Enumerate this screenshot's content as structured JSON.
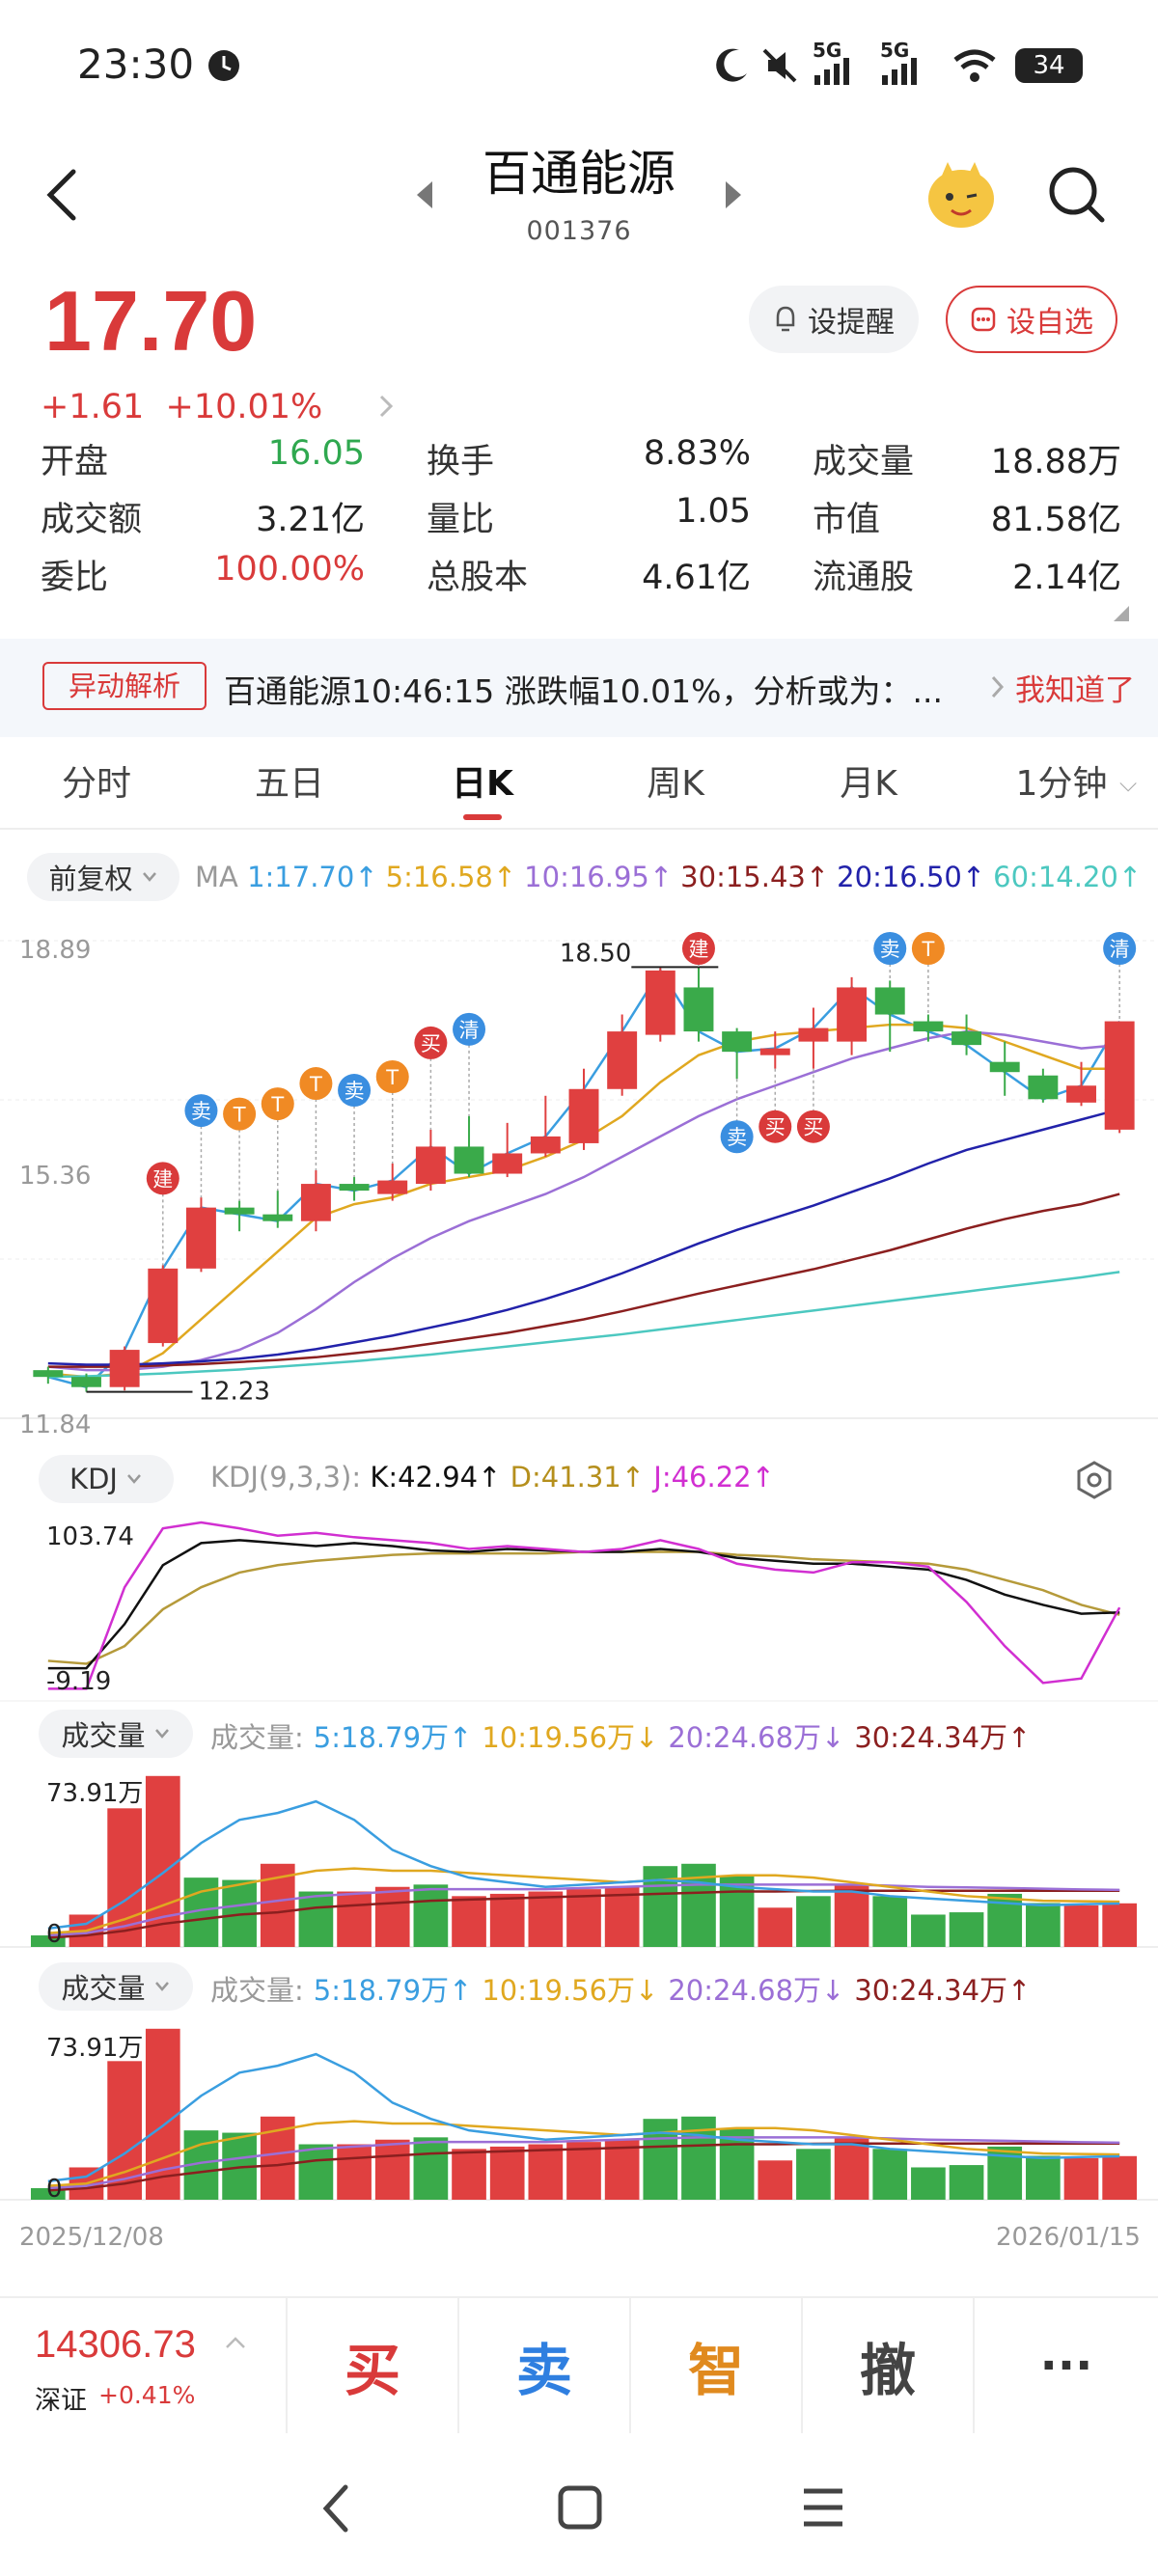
{
  "status": {
    "time": "23:30",
    "network": "5G",
    "network2": "5G",
    "battery": "34"
  },
  "header": {
    "title": "百通能源",
    "code": "001376",
    "back_icon": "chevron-left-icon",
    "search_icon": "search-icon",
    "prev_icon": "triangle-left-icon",
    "next_icon": "triangle-right-icon",
    "mascot_icon": "mascot-icon"
  },
  "quote": {
    "price": "17.70",
    "change": "+1.61",
    "change_pct": "+10.01%",
    "alert_label": "设提醒",
    "watch_label": "设自选"
  },
  "stats": [
    [
      {
        "label": "开盘",
        "value": "16.05",
        "color": "#2fa84f"
      },
      {
        "label": "换手",
        "value": "8.83%",
        "color": "#222"
      },
      {
        "label": "成交量",
        "value": "18.88万",
        "color": "#222"
      }
    ],
    [
      {
        "label": "成交额",
        "value": "3.21亿",
        "color": "#222"
      },
      {
        "label": "量比",
        "value": "1.05",
        "color": "#222"
      },
      {
        "label": "市值",
        "value": "81.58亿",
        "color": "#222"
      }
    ],
    [
      {
        "label": "委比",
        "value": "100.00%",
        "color": "#d93a3a"
      },
      {
        "label": "总股本",
        "value": "4.61亿",
        "color": "#222"
      },
      {
        "label": "流通股",
        "value": "2.14亿",
        "color": "#222"
      }
    ]
  ],
  "banner": {
    "tag": "异动解析",
    "text": "百通能源10:46:15 涨跌幅10.01%，分析或为：...",
    "action": "我知道了"
  },
  "tabs": [
    "分时",
    "五日",
    "日K",
    "周K",
    "月K",
    "1分钟"
  ],
  "active_tab": "日K",
  "ma_bar": {
    "mode": "前复权",
    "prefix": "MA",
    "items": [
      {
        "t": "1:17.70↑",
        "c": "#3a9ee0"
      },
      {
        "t": "5:16.58↑",
        "c": "#e0a820"
      },
      {
        "t": "10:16.95↑",
        "c": "#9b6fd6"
      },
      {
        "t": "30:15.43↑",
        "c": "#8b1f1f"
      },
      {
        "t": "20:16.50↑",
        "c": "#2222aa"
      },
      {
        "t": "60:14.20↑",
        "c": "#4cc8c0"
      }
    ]
  },
  "kline": {
    "ymax": "18.89",
    "ymid": "15.36",
    "ymin": "11.84",
    "high_label": "18.50",
    "low_label": "12.23"
  },
  "kdj": {
    "name": "KDJ",
    "params": "KDJ(9,3,3):",
    "k": "K:42.94↑",
    "d": "D:41.31↑",
    "j": "J:46.22↑",
    "top": "103.74",
    "bottom": "-9.19",
    "settings_icon": "hexagon-settings-icon"
  },
  "vol1": {
    "name": "成交量",
    "prefix": "成交量:",
    "items": [
      {
        "t": "5:18.79万↑",
        "c": "#3a9ee0"
      },
      {
        "t": "10:19.56万↓",
        "c": "#e0a820"
      },
      {
        "t": "20:24.68万↓",
        "c": "#9b6fd6"
      },
      {
        "t": "30:24.34万↑",
        "c": "#8b1f1f"
      }
    ],
    "top": "73.91万",
    "zero": "0"
  },
  "vol2": {
    "name": "成交量",
    "prefix": "成交量:",
    "items": [
      {
        "t": "5:18.79万↑",
        "c": "#3a9ee0"
      },
      {
        "t": "10:19.56万↓",
        "c": "#e0a820"
      },
      {
        "t": "20:24.68万↓",
        "c": "#9b6fd6"
      },
      {
        "t": "30:24.34万↑",
        "c": "#8b1f1f"
      }
    ],
    "top": "73.91万",
    "zero": "0"
  },
  "dates": {
    "start": "2025/12/08",
    "end": "2026/01/15"
  },
  "bottom": {
    "index_value": "14306.73",
    "index_name": "深证",
    "index_pct": "+0.41%",
    "buy": "买",
    "sell": "卖",
    "smart": "智",
    "cancel": "撤",
    "more": "···"
  },
  "chart_data": {
    "type": "candlestick",
    "candles": [
      {
        "o": 12.55,
        "c": 12.45,
        "h": 12.6,
        "l": 12.35
      },
      {
        "o": 12.45,
        "c": 12.3,
        "h": 12.5,
        "l": 12.23
      },
      {
        "o": 12.3,
        "c": 12.85,
        "h": 12.9,
        "l": 12.25
      },
      {
        "o": 12.95,
        "c": 14.05,
        "h": 14.1,
        "l": 12.9
      },
      {
        "o": 14.05,
        "c": 14.95,
        "h": 15.1,
        "l": 14.0
      },
      {
        "o": 14.95,
        "c": 14.85,
        "h": 15.05,
        "l": 14.6
      },
      {
        "o": 14.85,
        "c": 14.75,
        "h": 15.2,
        "l": 14.65
      },
      {
        "o": 14.75,
        "c": 15.3,
        "h": 15.5,
        "l": 14.6
      },
      {
        "o": 15.3,
        "c": 15.2,
        "h": 15.4,
        "l": 15.05
      },
      {
        "o": 15.15,
        "c": 15.35,
        "h": 15.6,
        "l": 15.05
      },
      {
        "o": 15.3,
        "c": 15.85,
        "h": 16.1,
        "l": 15.2
      },
      {
        "o": 15.85,
        "c": 15.45,
        "h": 16.3,
        "l": 15.4
      },
      {
        "o": 15.45,
        "c": 15.75,
        "h": 16.2,
        "l": 15.4
      },
      {
        "o": 15.75,
        "c": 16.0,
        "h": 16.6,
        "l": 15.7
      },
      {
        "o": 15.9,
        "c": 16.7,
        "h": 17.0,
        "l": 15.8
      },
      {
        "o": 16.7,
        "c": 17.55,
        "h": 17.8,
        "l": 16.6
      },
      {
        "o": 17.5,
        "c": 18.45,
        "h": 18.5,
        "l": 17.4
      },
      {
        "o": 18.2,
        "c": 17.55,
        "h": 18.5,
        "l": 17.4
      },
      {
        "o": 17.55,
        "c": 17.25,
        "h": 17.6,
        "l": 16.85
      },
      {
        "o": 17.2,
        "c": 17.3,
        "h": 17.55,
        "l": 17.0
      },
      {
        "o": 17.4,
        "c": 17.6,
        "h": 17.9,
        "l": 17.0
      },
      {
        "o": 17.4,
        "c": 18.2,
        "h": 18.35,
        "l": 17.2
      },
      {
        "o": 18.2,
        "c": 17.8,
        "h": 18.3,
        "l": 17.25
      },
      {
        "o": 17.7,
        "c": 17.55,
        "h": 17.8,
        "l": 17.4
      },
      {
        "o": 17.55,
        "c": 17.35,
        "h": 17.8,
        "l": 17.2
      },
      {
        "o": 17.1,
        "c": 16.95,
        "h": 17.4,
        "l": 16.6
      },
      {
        "o": 16.9,
        "c": 16.55,
        "h": 17.0,
        "l": 16.5
      },
      {
        "o": 16.5,
        "c": 16.75,
        "h": 17.1,
        "l": 16.45
      },
      {
        "o": 16.1,
        "c": 17.7,
        "h": 17.7,
        "l": 16.05
      }
    ],
    "ma_lines": [
      {
        "name": "1",
        "color": "#3a9ee0",
        "values": [
          12.45,
          12.3,
          12.85,
          14.05,
          14.95,
          14.85,
          14.75,
          15.3,
          15.2,
          15.35,
          15.85,
          15.45,
          15.75,
          16.0,
          16.7,
          17.55,
          18.45,
          17.55,
          17.25,
          17.3,
          17.6,
          18.2,
          17.8,
          17.55,
          17.35,
          16.95,
          16.55,
          16.75,
          17.7
        ]
      },
      {
        "name": "5",
        "color": "#e0a820",
        "values": [
          12.5,
          12.45,
          12.5,
          12.8,
          13.3,
          13.8,
          14.3,
          14.8,
          15.0,
          15.1,
          15.3,
          15.4,
          15.5,
          15.7,
          15.95,
          16.3,
          16.8,
          17.2,
          17.4,
          17.5,
          17.55,
          17.6,
          17.65,
          17.65,
          17.6,
          17.4,
          17.2,
          17.0,
          17.0
        ]
      },
      {
        "name": "10",
        "color": "#9b6fd6",
        "values": [
          12.6,
          12.55,
          12.55,
          12.6,
          12.7,
          12.85,
          13.1,
          13.45,
          13.85,
          14.2,
          14.5,
          14.75,
          14.95,
          15.15,
          15.4,
          15.7,
          16.0,
          16.3,
          16.55,
          16.75,
          16.95,
          17.15,
          17.3,
          17.45,
          17.55,
          17.5,
          17.4,
          17.3,
          17.35
        ]
      },
      {
        "name": "30",
        "color": "#8b1f1f",
        "values": [
          12.6,
          12.6,
          12.6,
          12.62,
          12.64,
          12.67,
          12.7,
          12.74,
          12.8,
          12.86,
          12.94,
          13.02,
          13.1,
          13.2,
          13.3,
          13.42,
          13.55,
          13.68,
          13.8,
          13.92,
          14.04,
          14.18,
          14.32,
          14.48,
          14.64,
          14.78,
          14.9,
          15.0,
          15.15
        ]
      },
      {
        "name": "20",
        "color": "#2222aa",
        "values": [
          12.65,
          12.63,
          12.63,
          12.65,
          12.68,
          12.72,
          12.78,
          12.86,
          12.96,
          13.06,
          13.18,
          13.3,
          13.44,
          13.6,
          13.78,
          13.98,
          14.2,
          14.42,
          14.62,
          14.8,
          14.98,
          15.18,
          15.38,
          15.6,
          15.8,
          15.95,
          16.1,
          16.25,
          16.4
        ]
      },
      {
        "name": "60",
        "color": "#4cc8c0",
        "values": [
          12.45,
          12.46,
          12.48,
          12.5,
          12.53,
          12.56,
          12.6,
          12.64,
          12.68,
          12.73,
          12.78,
          12.84,
          12.9,
          12.96,
          13.02,
          13.08,
          13.15,
          13.22,
          13.29,
          13.36,
          13.43,
          13.5,
          13.57,
          13.64,
          13.71,
          13.78,
          13.85,
          13.92,
          14.0
        ]
      }
    ],
    "signals": [
      {
        "i": 3,
        "label": "建",
        "color": "#d93a3a",
        "pos": "above"
      },
      {
        "i": 4,
        "label": "卖",
        "color": "#3a8ee0",
        "pos": "above"
      },
      {
        "i": 5,
        "label": "T",
        "color": "#f08a24",
        "pos": "above"
      },
      {
        "i": 6,
        "label": "T",
        "color": "#f08a24",
        "pos": "above"
      },
      {
        "i": 7,
        "label": "T",
        "color": "#f08a24",
        "pos": "above"
      },
      {
        "i": 8,
        "label": "卖",
        "color": "#3a8ee0",
        "pos": "above"
      },
      {
        "i": 9,
        "label": "T",
        "color": "#f08a24",
        "pos": "above"
      },
      {
        "i": 10,
        "label": "买",
        "color": "#d93a3a",
        "pos": "above"
      },
      {
        "i": 11,
        "label": "清",
        "color": "#3a8ee0",
        "pos": "above"
      },
      {
        "i": 17,
        "label": "建",
        "color": "#d93a3a",
        "pos": "above"
      },
      {
        "i": 18,
        "label": "卖",
        "color": "#3a8ee0",
        "pos": "below"
      },
      {
        "i": 19,
        "label": "买",
        "color": "#d93a3a",
        "pos": "below"
      },
      {
        "i": 20,
        "label": "买",
        "color": "#d93a3a",
        "pos": "below"
      },
      {
        "i": 22,
        "label": "卖",
        "color": "#3a8ee0",
        "pos": "above"
      },
      {
        "i": 23,
        "label": "T",
        "color": "#f08a24",
        "pos": "above"
      },
      {
        "i": 28,
        "label": "清",
        "color": "#3a8ee0",
        "pos": "above"
      }
    ],
    "kdj": {
      "k": [
        5,
        5,
        35,
        75,
        90,
        92,
        90,
        88,
        90,
        88,
        85,
        84,
        86,
        85,
        84,
        84,
        86,
        84,
        80,
        78,
        76,
        76,
        74,
        72,
        65,
        55,
        48,
        42,
        42.94
      ],
      "d": [
        10,
        8,
        20,
        45,
        60,
        70,
        75,
        78,
        80,
        82,
        83,
        83,
        83,
        83,
        84,
        84,
        84,
        84,
        82,
        81,
        79,
        78,
        77,
        76,
        72,
        65,
        58,
        48,
        41.31
      ],
      "j": [
        -9,
        -9,
        60,
        100,
        104,
        100,
        95,
        97,
        94,
        92,
        90,
        86,
        88,
        86,
        84,
        86,
        92,
        86,
        76,
        72,
        70,
        77,
        77,
        74,
        50,
        20,
        -5,
        -2,
        46.22
      ]
    },
    "volume": {
      "values": [
        5,
        14,
        60,
        74,
        30,
        29,
        36,
        24,
        24,
        26,
        27,
        22,
        23,
        24,
        25,
        26,
        35,
        36,
        31,
        17,
        22,
        27,
        22,
        14,
        15,
        23,
        19,
        18,
        18.88
      ],
      "up": [
        false,
        true,
        true,
        true,
        false,
        false,
        true,
        false,
        true,
        true,
        false,
        true,
        true,
        true,
        true,
        true,
        false,
        false,
        false,
        true,
        false,
        true,
        false,
        false,
        false,
        false,
        false,
        true,
        true
      ],
      "ma5": [
        8,
        10,
        20,
        32,
        45,
        55,
        58,
        63,
        55,
        42,
        35,
        30,
        28,
        26,
        27,
        28,
        29,
        28,
        26,
        25,
        24,
        24,
        22,
        21,
        20,
        19,
        18,
        18.5,
        18.79
      ],
      "ma10": [
        6,
        7,
        12,
        18,
        24,
        27,
        30,
        33,
        34,
        33,
        33,
        32,
        31,
        30,
        29,
        28,
        29,
        30,
        31,
        31,
        30,
        28,
        26,
        24,
        22,
        21,
        20,
        19.8,
        19.56
      ],
      "ma20": [
        5,
        6,
        9,
        13,
        16,
        18,
        20,
        22,
        23,
        24,
        25,
        25,
        25,
        25,
        25.5,
        26,
        26.5,
        27,
        27,
        27,
        27,
        27,
        26.5,
        26,
        25.8,
        25.5,
        25.2,
        24.9,
        24.68
      ],
      "ma30": [
        4,
        5,
        7,
        10,
        12,
        14,
        15,
        17,
        18,
        19,
        20,
        20.5,
        21,
        21.5,
        22,
        22.5,
        23,
        23.5,
        24,
        24,
        24.2,
        24.3,
        24.3,
        24.3,
        24.3,
        24.3,
        24.3,
        24.3,
        24.34
      ]
    },
    "ylim": [
      11.84,
      18.89
    ]
  }
}
